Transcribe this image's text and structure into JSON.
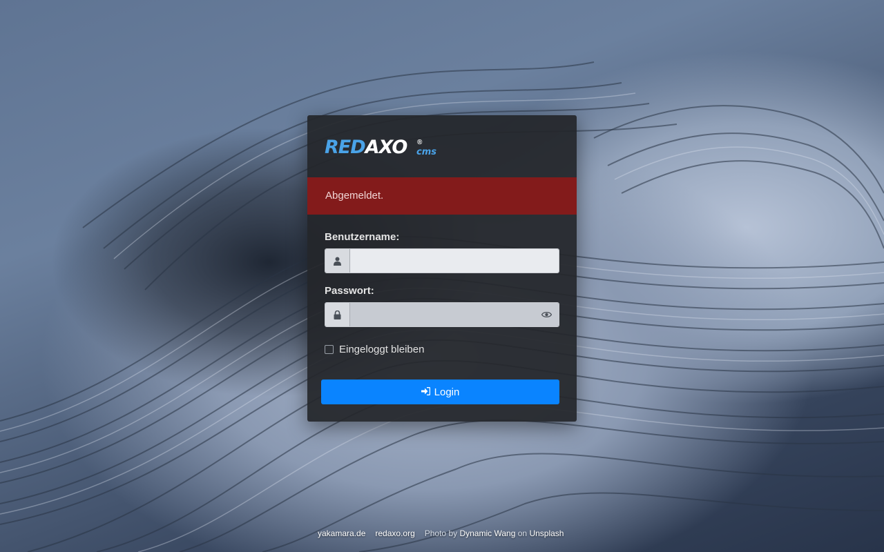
{
  "logo": {
    "red": "RED",
    "axo": "AXO",
    "reg": "®",
    "cms": "cms"
  },
  "alert": {
    "message": "Abgemeldet."
  },
  "form": {
    "username_label": "Benutzername:",
    "username_value": "",
    "password_label": "Passwort:",
    "password_value": "",
    "remember_label": "Eingeloggt bleiben",
    "remember_checked": false,
    "login_label": "Login"
  },
  "footer": {
    "link1": "yakamara.de",
    "link2": "redaxo.org",
    "credit_prefix": "Photo by",
    "credit_author": "Dynamic Wang",
    "credit_mid": "on",
    "credit_site": "Unsplash"
  },
  "colors": {
    "accent": "#0a84ff",
    "alert": "#831b1b",
    "logo_blue": "#4aa3e8"
  },
  "icons": {
    "user": "user-icon",
    "lock": "lock-icon",
    "eye": "eye-icon",
    "login": "sign-in-icon"
  }
}
